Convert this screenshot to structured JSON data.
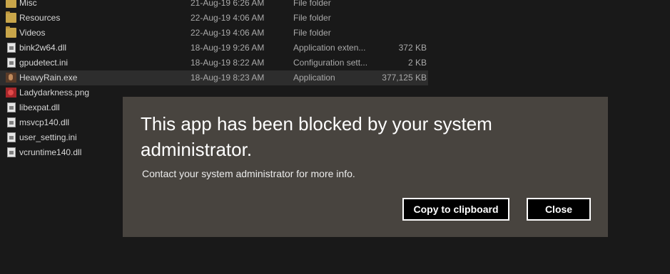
{
  "files": [
    {
      "icon": "folder-icon",
      "name": "Misc",
      "date": "21-Aug-19 6:26 AM",
      "type": "File folder",
      "size": ""
    },
    {
      "icon": "folder-icon",
      "name": "Resources",
      "date": "22-Aug-19 4:06 AM",
      "type": "File folder",
      "size": ""
    },
    {
      "icon": "folder-icon",
      "name": "Videos",
      "date": "22-Aug-19 4:06 AM",
      "type": "File folder",
      "size": ""
    },
    {
      "icon": "dll-file-icon",
      "name": "bink2w64.dll",
      "date": "18-Aug-19 9:26 AM",
      "type": "Application exten...",
      "size": "372 KB"
    },
    {
      "icon": "ini-file-icon",
      "name": "gpudetect.ini",
      "date": "18-Aug-19 8:22 AM",
      "type": "Configuration sett...",
      "size": "2 KB"
    },
    {
      "icon": "exe-app-icon",
      "name": "HeavyRain.exe",
      "date": "18-Aug-19 8:23 AM",
      "type": "Application",
      "size": "377,125 KB"
    },
    {
      "icon": "png-image-icon",
      "name": "Ladydarkness.png",
      "date": "",
      "type": "",
      "size": ""
    },
    {
      "icon": "dll-file-icon",
      "name": "libexpat.dll",
      "date": "",
      "type": "",
      "size": ""
    },
    {
      "icon": "dll-file-icon",
      "name": "msvcp140.dll",
      "date": "",
      "type": "",
      "size": ""
    },
    {
      "icon": "ini-file-icon",
      "name": "user_setting.ini",
      "date": "",
      "type": "",
      "size": ""
    },
    {
      "icon": "dll-file-icon",
      "name": "vcruntime140.dll",
      "date": "",
      "type": "",
      "size": ""
    }
  ],
  "dialog": {
    "title": "This app has been blocked by your system administrator.",
    "message": "Contact your system administrator for more info.",
    "copy_label": "Copy to clipboard",
    "close_label": "Close"
  }
}
